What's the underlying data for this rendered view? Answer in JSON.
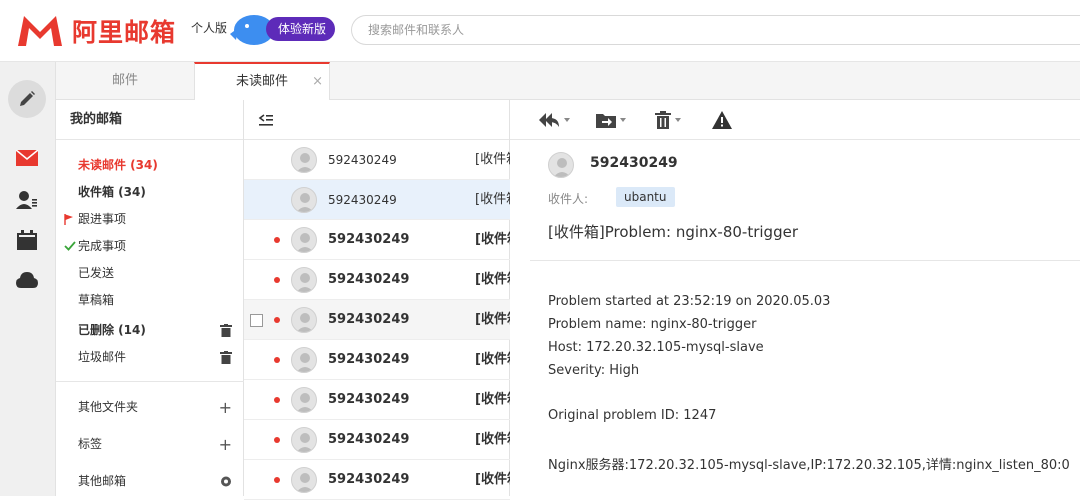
{
  "header": {
    "brand": "阿里邮箱",
    "edition": "个人版",
    "new_version_label": "体验新版",
    "search_placeholder": "搜索邮件和联系人",
    "colors": {
      "brand_red": "#e8392f",
      "new_version_purple": "#5d2bb9"
    }
  },
  "rail": {
    "icons": [
      "compose-icon",
      "mail-icon",
      "contacts-icon",
      "calendar-icon",
      "cloud-icon"
    ]
  },
  "tabs": [
    {
      "label": "邮件",
      "active": false
    },
    {
      "label": "未读邮件",
      "active": true,
      "close": "×"
    }
  ],
  "folders": {
    "title": "我的邮箱",
    "items": [
      {
        "label": "未读邮件 (34)"
      },
      {
        "label": "收件箱 (34)"
      },
      {
        "label": "跟进事项"
      },
      {
        "label": "完成事项"
      },
      {
        "label": "已发送"
      },
      {
        "label": "草稿箱"
      },
      {
        "label": "已删除 (14)"
      },
      {
        "label": "垃圾邮件"
      }
    ],
    "groups": [
      {
        "label": "其他文件夹"
      },
      {
        "label": "标签"
      },
      {
        "label": "其他邮箱"
      }
    ]
  },
  "list": {
    "rows": [
      {
        "from": "592430249",
        "subject": "[收件箱]",
        "unread": false,
        "selected": false
      },
      {
        "from": "592430249",
        "subject": "[收件箱]",
        "unread": false,
        "selected": true
      },
      {
        "from": "592430249",
        "subject": "[收件箱]",
        "unread": true,
        "selected": false
      },
      {
        "from": "592430249",
        "subject": "[收件箱]",
        "unread": true,
        "selected": false
      },
      {
        "from": "592430249",
        "subject": "[收件箱]",
        "unread": true,
        "selected": false,
        "hover": true
      },
      {
        "from": "592430249",
        "subject": "[收件箱]",
        "unread": true,
        "selected": false
      },
      {
        "from": "592430249",
        "subject": "[收件箱]",
        "unread": true,
        "selected": false
      },
      {
        "from": "592430249",
        "subject": "[收件箱]",
        "unread": true,
        "selected": false
      },
      {
        "from": "592430249",
        "subject": "[收件箱]",
        "unread": true,
        "selected": false
      }
    ]
  },
  "reader": {
    "toolbar": [
      "reply-icon",
      "move-icon",
      "delete-icon",
      "report-icon"
    ],
    "sender": "592430249",
    "to_label": "收件人:",
    "to": "ubantu",
    "subject": "[收件箱]Problem: nginx-80-trigger",
    "body": [
      "Problem started at 23:52:19 on 2020.05.03",
      "Problem name: nginx-80-trigger",
      "Host: 172.20.32.105-mysql-slave",
      "Severity: High",
      "Original problem ID: 1247",
      "Nginx服务器:172.20.32.105-mysql-slave,IP:172.20.32.105,详情:nginx_listen_80:0"
    ]
  }
}
